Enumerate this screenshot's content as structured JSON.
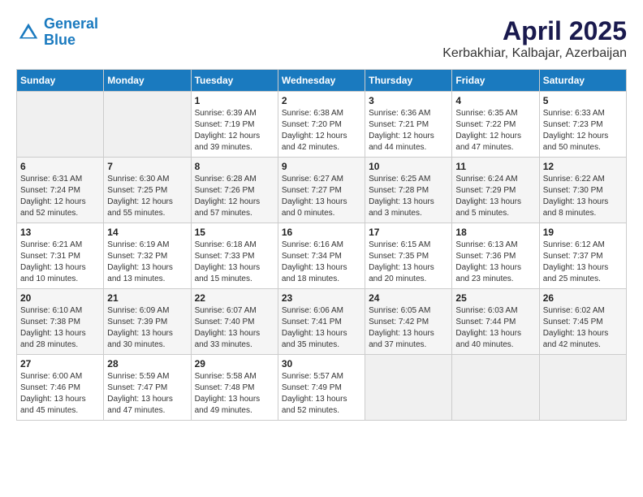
{
  "logo": {
    "line1": "General",
    "line2": "Blue"
  },
  "title": "April 2025",
  "subtitle": "Kerbakhiar, Kalbajar, Azerbaijan",
  "weekdays": [
    "Sunday",
    "Monday",
    "Tuesday",
    "Wednesday",
    "Thursday",
    "Friday",
    "Saturday"
  ],
  "weeks": [
    [
      {
        "day": "",
        "sunrise": "",
        "sunset": "",
        "daylight": ""
      },
      {
        "day": "",
        "sunrise": "",
        "sunset": "",
        "daylight": ""
      },
      {
        "day": "1",
        "sunrise": "Sunrise: 6:39 AM",
        "sunset": "Sunset: 7:19 PM",
        "daylight": "Daylight: 12 hours and 39 minutes."
      },
      {
        "day": "2",
        "sunrise": "Sunrise: 6:38 AM",
        "sunset": "Sunset: 7:20 PM",
        "daylight": "Daylight: 12 hours and 42 minutes."
      },
      {
        "day": "3",
        "sunrise": "Sunrise: 6:36 AM",
        "sunset": "Sunset: 7:21 PM",
        "daylight": "Daylight: 12 hours and 44 minutes."
      },
      {
        "day": "4",
        "sunrise": "Sunrise: 6:35 AM",
        "sunset": "Sunset: 7:22 PM",
        "daylight": "Daylight: 12 hours and 47 minutes."
      },
      {
        "day": "5",
        "sunrise": "Sunrise: 6:33 AM",
        "sunset": "Sunset: 7:23 PM",
        "daylight": "Daylight: 12 hours and 50 minutes."
      }
    ],
    [
      {
        "day": "6",
        "sunrise": "Sunrise: 6:31 AM",
        "sunset": "Sunset: 7:24 PM",
        "daylight": "Daylight: 12 hours and 52 minutes."
      },
      {
        "day": "7",
        "sunrise": "Sunrise: 6:30 AM",
        "sunset": "Sunset: 7:25 PM",
        "daylight": "Daylight: 12 hours and 55 minutes."
      },
      {
        "day": "8",
        "sunrise": "Sunrise: 6:28 AM",
        "sunset": "Sunset: 7:26 PM",
        "daylight": "Daylight: 12 hours and 57 minutes."
      },
      {
        "day": "9",
        "sunrise": "Sunrise: 6:27 AM",
        "sunset": "Sunset: 7:27 PM",
        "daylight": "Daylight: 13 hours and 0 minutes."
      },
      {
        "day": "10",
        "sunrise": "Sunrise: 6:25 AM",
        "sunset": "Sunset: 7:28 PM",
        "daylight": "Daylight: 13 hours and 3 minutes."
      },
      {
        "day": "11",
        "sunrise": "Sunrise: 6:24 AM",
        "sunset": "Sunset: 7:29 PM",
        "daylight": "Daylight: 13 hours and 5 minutes."
      },
      {
        "day": "12",
        "sunrise": "Sunrise: 6:22 AM",
        "sunset": "Sunset: 7:30 PM",
        "daylight": "Daylight: 13 hours and 8 minutes."
      }
    ],
    [
      {
        "day": "13",
        "sunrise": "Sunrise: 6:21 AM",
        "sunset": "Sunset: 7:31 PM",
        "daylight": "Daylight: 13 hours and 10 minutes."
      },
      {
        "day": "14",
        "sunrise": "Sunrise: 6:19 AM",
        "sunset": "Sunset: 7:32 PM",
        "daylight": "Daylight: 13 hours and 13 minutes."
      },
      {
        "day": "15",
        "sunrise": "Sunrise: 6:18 AM",
        "sunset": "Sunset: 7:33 PM",
        "daylight": "Daylight: 13 hours and 15 minutes."
      },
      {
        "day": "16",
        "sunrise": "Sunrise: 6:16 AM",
        "sunset": "Sunset: 7:34 PM",
        "daylight": "Daylight: 13 hours and 18 minutes."
      },
      {
        "day": "17",
        "sunrise": "Sunrise: 6:15 AM",
        "sunset": "Sunset: 7:35 PM",
        "daylight": "Daylight: 13 hours and 20 minutes."
      },
      {
        "day": "18",
        "sunrise": "Sunrise: 6:13 AM",
        "sunset": "Sunset: 7:36 PM",
        "daylight": "Daylight: 13 hours and 23 minutes."
      },
      {
        "day": "19",
        "sunrise": "Sunrise: 6:12 AM",
        "sunset": "Sunset: 7:37 PM",
        "daylight": "Daylight: 13 hours and 25 minutes."
      }
    ],
    [
      {
        "day": "20",
        "sunrise": "Sunrise: 6:10 AM",
        "sunset": "Sunset: 7:38 PM",
        "daylight": "Daylight: 13 hours and 28 minutes."
      },
      {
        "day": "21",
        "sunrise": "Sunrise: 6:09 AM",
        "sunset": "Sunset: 7:39 PM",
        "daylight": "Daylight: 13 hours and 30 minutes."
      },
      {
        "day": "22",
        "sunrise": "Sunrise: 6:07 AM",
        "sunset": "Sunset: 7:40 PM",
        "daylight": "Daylight: 13 hours and 33 minutes."
      },
      {
        "day": "23",
        "sunrise": "Sunrise: 6:06 AM",
        "sunset": "Sunset: 7:41 PM",
        "daylight": "Daylight: 13 hours and 35 minutes."
      },
      {
        "day": "24",
        "sunrise": "Sunrise: 6:05 AM",
        "sunset": "Sunset: 7:42 PM",
        "daylight": "Daylight: 13 hours and 37 minutes."
      },
      {
        "day": "25",
        "sunrise": "Sunrise: 6:03 AM",
        "sunset": "Sunset: 7:44 PM",
        "daylight": "Daylight: 13 hours and 40 minutes."
      },
      {
        "day": "26",
        "sunrise": "Sunrise: 6:02 AM",
        "sunset": "Sunset: 7:45 PM",
        "daylight": "Daylight: 13 hours and 42 minutes."
      }
    ],
    [
      {
        "day": "27",
        "sunrise": "Sunrise: 6:00 AM",
        "sunset": "Sunset: 7:46 PM",
        "daylight": "Daylight: 13 hours and 45 minutes."
      },
      {
        "day": "28",
        "sunrise": "Sunrise: 5:59 AM",
        "sunset": "Sunset: 7:47 PM",
        "daylight": "Daylight: 13 hours and 47 minutes."
      },
      {
        "day": "29",
        "sunrise": "Sunrise: 5:58 AM",
        "sunset": "Sunset: 7:48 PM",
        "daylight": "Daylight: 13 hours and 49 minutes."
      },
      {
        "day": "30",
        "sunrise": "Sunrise: 5:57 AM",
        "sunset": "Sunset: 7:49 PM",
        "daylight": "Daylight: 13 hours and 52 minutes."
      },
      {
        "day": "",
        "sunrise": "",
        "sunset": "",
        "daylight": ""
      },
      {
        "day": "",
        "sunrise": "",
        "sunset": "",
        "daylight": ""
      },
      {
        "day": "",
        "sunrise": "",
        "sunset": "",
        "daylight": ""
      }
    ]
  ]
}
